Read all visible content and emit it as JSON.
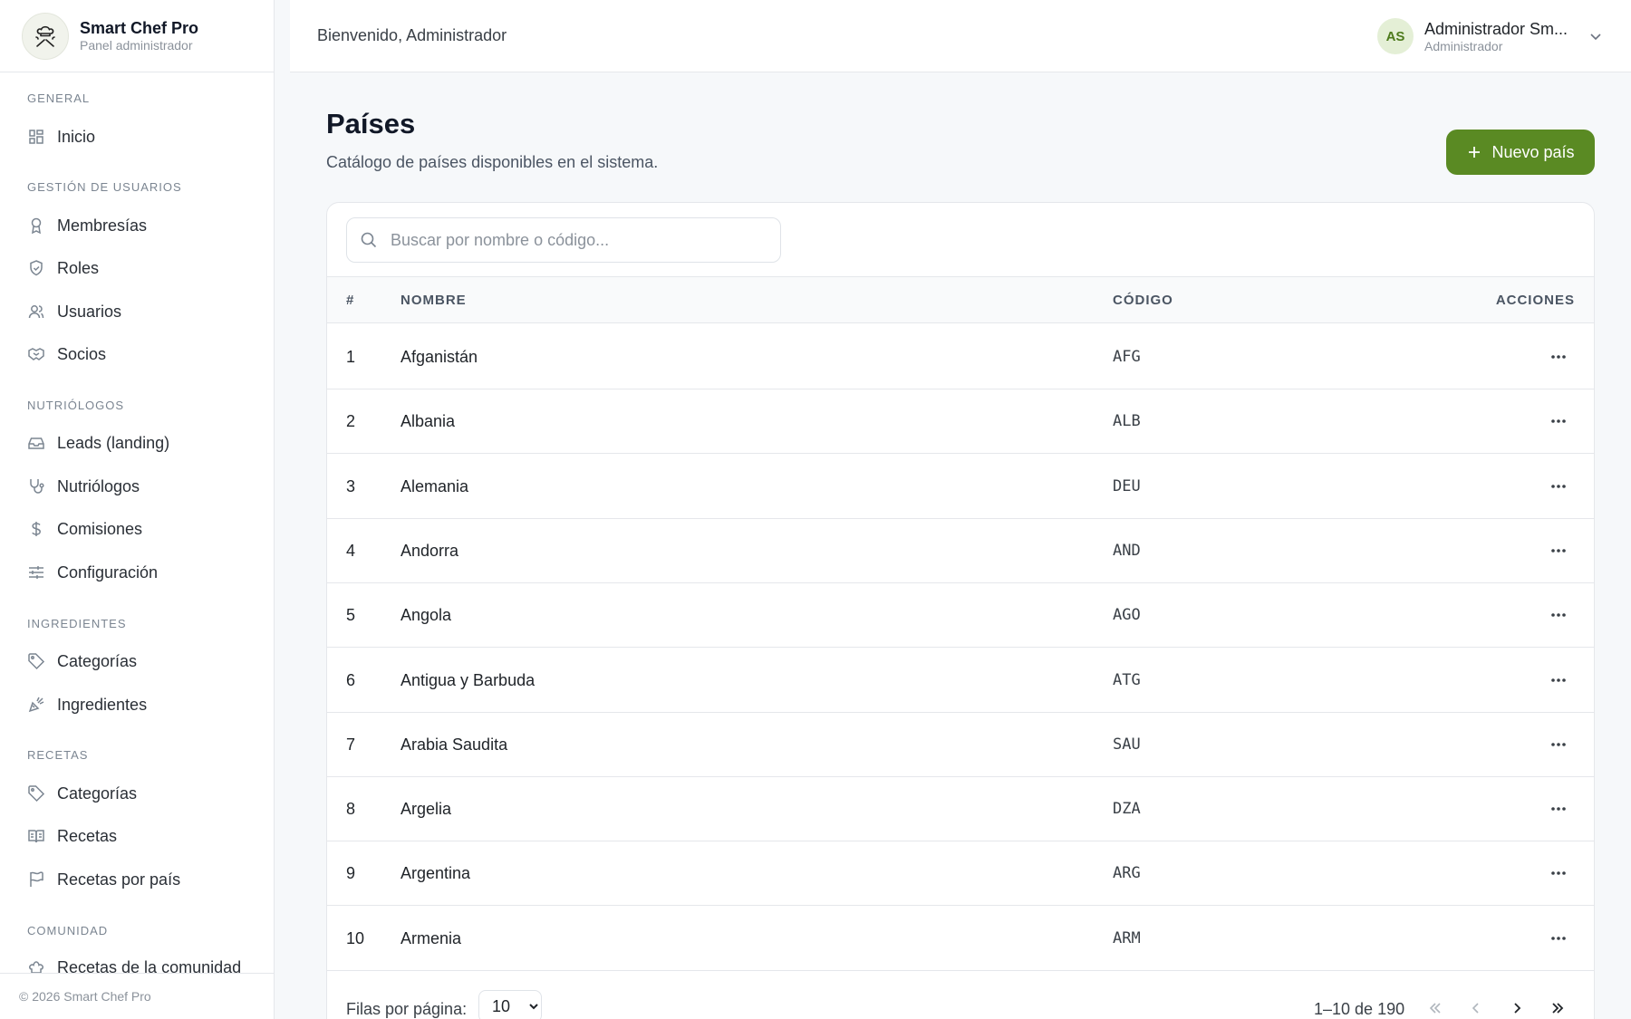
{
  "brand": {
    "title": "Smart Chef Pro",
    "subtitle": "Panel administrador"
  },
  "sidebar": {
    "sections": [
      {
        "title": "General",
        "items": [
          {
            "label": "Inicio",
            "icon": "grid-icon"
          }
        ]
      },
      {
        "title": "Gestión de usuarios",
        "items": [
          {
            "label": "Membresías",
            "icon": "award-icon"
          },
          {
            "label": "Roles",
            "icon": "shield-icon"
          },
          {
            "label": "Usuarios",
            "icon": "users-icon"
          },
          {
            "label": "Socios",
            "icon": "handshake-icon"
          }
        ]
      },
      {
        "title": "Nutriólogos",
        "items": [
          {
            "label": "Leads (landing)",
            "icon": "inbox-icon"
          },
          {
            "label": "Nutriólogos",
            "icon": "stethoscope-icon"
          },
          {
            "label": "Comisiones",
            "icon": "dollar-icon"
          },
          {
            "label": "Configuración",
            "icon": "sliders-icon"
          }
        ]
      },
      {
        "title": "Ingredientes",
        "items": [
          {
            "label": "Categorías",
            "icon": "tag-icon"
          },
          {
            "label": "Ingredientes",
            "icon": "carrot-icon"
          }
        ]
      },
      {
        "title": "Recetas",
        "items": [
          {
            "label": "Categorías",
            "icon": "tag-icon"
          },
          {
            "label": "Recetas",
            "icon": "book-icon"
          },
          {
            "label": "Recetas por país",
            "icon": "flag-icon"
          }
        ]
      },
      {
        "title": "Comunidad",
        "items": [
          {
            "label": "Recetas de la comunidad",
            "icon": "chef-hat-icon"
          }
        ]
      }
    ],
    "footer": "© 2026 Smart Chef Pro"
  },
  "header": {
    "welcome": "Bienvenido, Administrador",
    "user": {
      "initials": "AS",
      "name": "Administrador Sm...",
      "role": "Administrador"
    }
  },
  "page": {
    "title": "Países",
    "description": "Catálogo de países disponibles en el sistema.",
    "new_button": "Nuevo país"
  },
  "search": {
    "placeholder": "Buscar por nombre o código..."
  },
  "table": {
    "columns": [
      "#",
      "NOMBRE",
      "CÓDIGO",
      "ACCIONES"
    ],
    "rows": [
      {
        "n": "1",
        "name": "Afganistán",
        "code": "AFG"
      },
      {
        "n": "2",
        "name": "Albania",
        "code": "ALB"
      },
      {
        "n": "3",
        "name": "Alemania",
        "code": "DEU"
      },
      {
        "n": "4",
        "name": "Andorra",
        "code": "AND"
      },
      {
        "n": "5",
        "name": "Angola",
        "code": "AGO"
      },
      {
        "n": "6",
        "name": "Antigua y Barbuda",
        "code": "ATG"
      },
      {
        "n": "7",
        "name": "Arabia Saudita",
        "code": "SAU"
      },
      {
        "n": "8",
        "name": "Argelia",
        "code": "DZA"
      },
      {
        "n": "9",
        "name": "Argentina",
        "code": "ARG"
      },
      {
        "n": "10",
        "name": "Armenia",
        "code": "ARM"
      }
    ]
  },
  "pagination": {
    "rows_label": "Filas por página:",
    "page_size": "10",
    "range": "1–10 de 190"
  },
  "colors": {
    "accent": "#5a8a23",
    "avatar_bg": "#e4efd6",
    "avatar_text": "#4d7a1c"
  }
}
